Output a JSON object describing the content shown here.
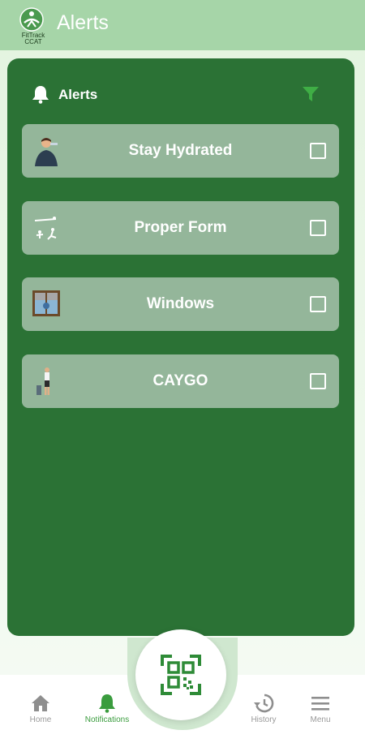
{
  "header": {
    "title": "Alerts",
    "logo_text_line1": "FitTrack",
    "logo_text_line2": "CCAT",
    "bg_color": "#a6d5a8"
  },
  "panel": {
    "title": "Alerts",
    "bg_color": "#2b7235",
    "filter_icon": "filter-icon",
    "bell_icon": "bell-icon"
  },
  "alerts": [
    {
      "label": "Stay Hydrated",
      "icon": "person-drinking-icon",
      "checked": false
    },
    {
      "label": "Proper Form",
      "icon": "exercise-figures-icon",
      "checked": false
    },
    {
      "label": "Windows",
      "icon": "window-icon",
      "checked": false
    },
    {
      "label": "CAYGO",
      "icon": "person-cleaning-icon",
      "checked": false
    }
  ],
  "nav": {
    "items": [
      {
        "label": "Home",
        "icon": "home-icon"
      },
      {
        "label": "Notifications",
        "icon": "bell-icon"
      },
      {
        "label": "History",
        "icon": "history-icon"
      },
      {
        "label": "Menu",
        "icon": "menu-icon"
      }
    ],
    "active": "Notifications",
    "fab_icon": "qr-scan-icon",
    "accent_color": "#3a9c3e"
  }
}
